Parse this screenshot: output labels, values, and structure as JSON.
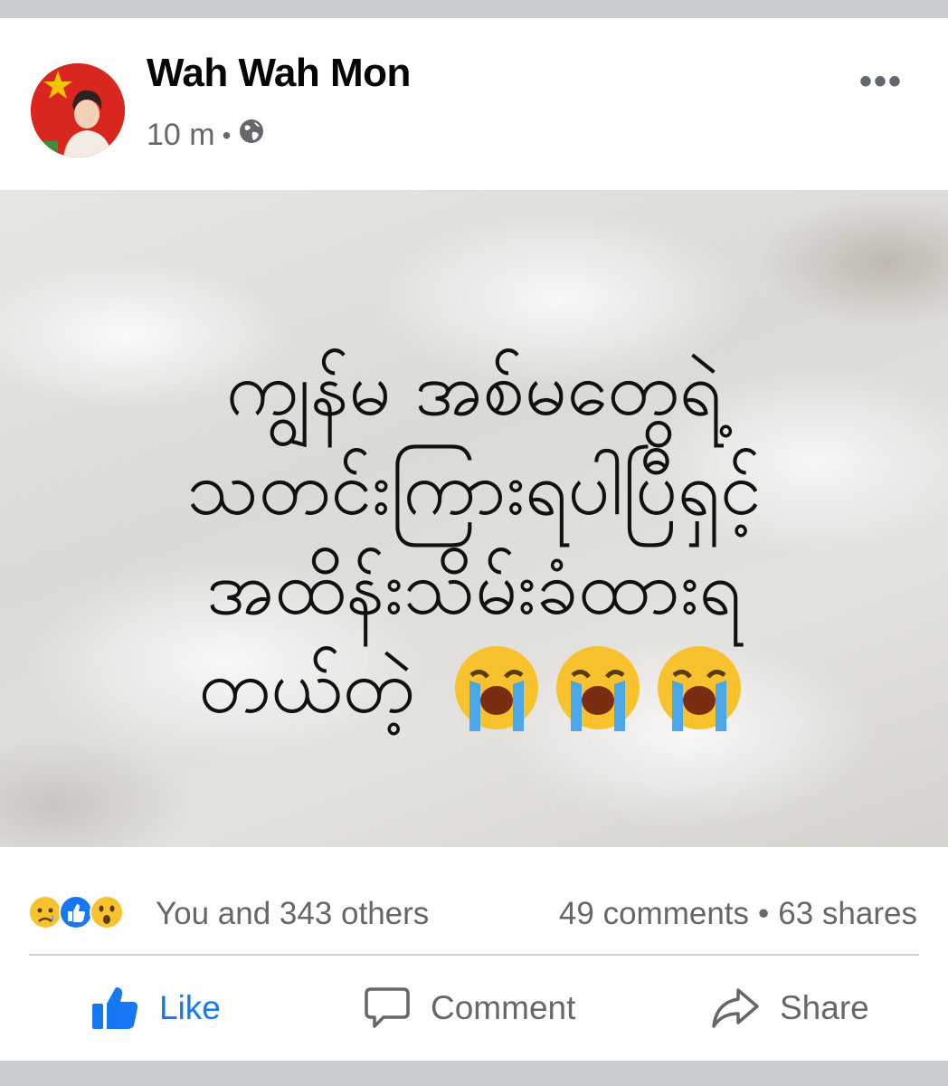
{
  "post": {
    "author": "Wah Wah Mon",
    "time": "10 m",
    "separator": "•",
    "privacy_icon": "globe-icon",
    "more_icon": "more-dots-icon"
  },
  "image_text": {
    "line1": "ကျွန်မ အစ်မတွေရဲ့",
    "line2": "သတင်းကြားရပါပြီရှင့်",
    "line3": "အထိန်းသိမ်းခံထားရ",
    "line4": "တယ်တဲ့",
    "emoji": "loudly-crying-face-icon"
  },
  "stats": {
    "reactions": [
      "sad-face-icon",
      "like-icon",
      "wow-face-icon"
    ],
    "reaction_text": "You and 343 others",
    "comments": "49 comments",
    "dot": "•",
    "shares": "63 shares"
  },
  "actions": {
    "like": "Like",
    "comment": "Comment",
    "share": "Share"
  },
  "colors": {
    "accent": "#1877f2",
    "secondary_text": "#65676b",
    "primary_text": "#050505"
  }
}
